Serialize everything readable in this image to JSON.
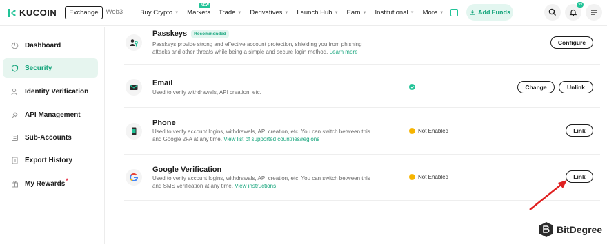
{
  "brand": {
    "name": "KUCOIN"
  },
  "header": {
    "segment": {
      "active": "Exchange",
      "inactive": "Web3"
    },
    "nav": [
      {
        "label": "Buy Crypto"
      },
      {
        "label": "Markets",
        "badge": "NEW"
      },
      {
        "label": "Trade"
      },
      {
        "label": "Derivatives"
      },
      {
        "label": "Launch Hub"
      },
      {
        "label": "Earn"
      },
      {
        "label": "Institutional"
      },
      {
        "label": "More"
      }
    ],
    "add_funds": "Add Funds",
    "notification_count": "99"
  },
  "sidebar": {
    "items": [
      {
        "label": "Dashboard",
        "icon": "dashboard-icon"
      },
      {
        "label": "Security",
        "icon": "shield-icon",
        "active": true
      },
      {
        "label": "Identity Verification",
        "icon": "identity-icon"
      },
      {
        "label": "API Management",
        "icon": "api-icon"
      },
      {
        "label": "Sub-Accounts",
        "icon": "sub-accounts-icon"
      },
      {
        "label": "Export History",
        "icon": "export-icon"
      },
      {
        "label": "My Rewards",
        "icon": "rewards-icon",
        "dot": "*"
      }
    ]
  },
  "security": {
    "passkeys": {
      "title": "Passkeys",
      "badge": "Recommended",
      "desc_1": "Passkeys provide strong and effective account protection, shielding you from phishing",
      "desc_2": "attacks and other threats while being a simple and secure login method.",
      "link": "Learn more",
      "button": "Configure"
    },
    "email": {
      "title": "Email",
      "desc": "Used to verify withdrawals, API creation, etc.",
      "buttons": {
        "change": "Change",
        "unlink": "Unlink"
      }
    },
    "phone": {
      "title": "Phone",
      "desc_1": "Used to verify account logins, withdrawals, API creation, etc. You can switch between this",
      "desc_2": "and Google 2FA at any time.",
      "link": "View list of supported countries/regions",
      "status": "Not Enabled",
      "button": "Link"
    },
    "google": {
      "title": "Google Verification",
      "desc_1": "Used to verify account logins, withdrawals, API creation, etc. You can switch between this",
      "desc_2": "and SMS verification at any time.",
      "link": "View instructions",
      "status": "Not Enabled",
      "button": "Link"
    }
  },
  "watermark": "BitDegree",
  "colors": {
    "accent": "#21c397",
    "accent_dark": "#16a57c",
    "warning": "#f6b400",
    "arrow": "#e02020"
  }
}
